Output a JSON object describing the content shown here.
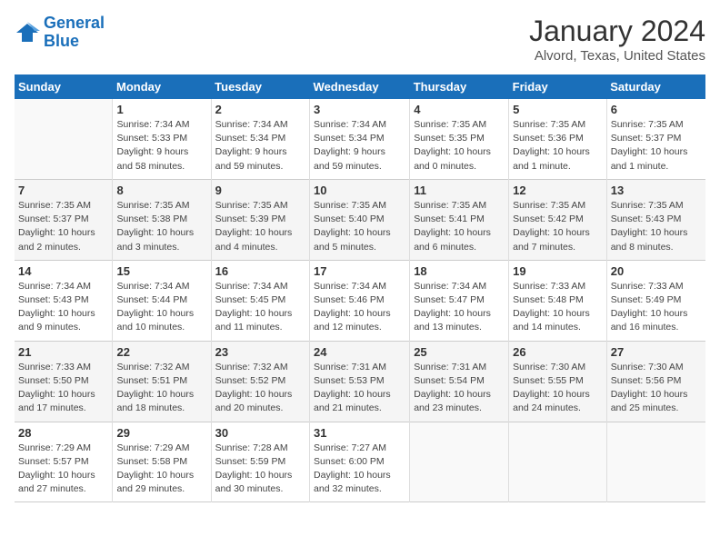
{
  "header": {
    "logo_line1": "General",
    "logo_line2": "Blue",
    "month": "January 2024",
    "location": "Alvord, Texas, United States"
  },
  "weekdays": [
    "Sunday",
    "Monday",
    "Tuesday",
    "Wednesday",
    "Thursday",
    "Friday",
    "Saturday"
  ],
  "weeks": [
    [
      {
        "day": "",
        "detail": ""
      },
      {
        "day": "1",
        "detail": "Sunrise: 7:34 AM\nSunset: 5:33 PM\nDaylight: 9 hours\nand 58 minutes."
      },
      {
        "day": "2",
        "detail": "Sunrise: 7:34 AM\nSunset: 5:34 PM\nDaylight: 9 hours\nand 59 minutes."
      },
      {
        "day": "3",
        "detail": "Sunrise: 7:34 AM\nSunset: 5:34 PM\nDaylight: 9 hours\nand 59 minutes."
      },
      {
        "day": "4",
        "detail": "Sunrise: 7:35 AM\nSunset: 5:35 PM\nDaylight: 10 hours\nand 0 minutes."
      },
      {
        "day": "5",
        "detail": "Sunrise: 7:35 AM\nSunset: 5:36 PM\nDaylight: 10 hours\nand 1 minute."
      },
      {
        "day": "6",
        "detail": "Sunrise: 7:35 AM\nSunset: 5:37 PM\nDaylight: 10 hours\nand 1 minute."
      }
    ],
    [
      {
        "day": "7",
        "detail": "Sunrise: 7:35 AM\nSunset: 5:37 PM\nDaylight: 10 hours\nand 2 minutes."
      },
      {
        "day": "8",
        "detail": "Sunrise: 7:35 AM\nSunset: 5:38 PM\nDaylight: 10 hours\nand 3 minutes."
      },
      {
        "day": "9",
        "detail": "Sunrise: 7:35 AM\nSunset: 5:39 PM\nDaylight: 10 hours\nand 4 minutes."
      },
      {
        "day": "10",
        "detail": "Sunrise: 7:35 AM\nSunset: 5:40 PM\nDaylight: 10 hours\nand 5 minutes."
      },
      {
        "day": "11",
        "detail": "Sunrise: 7:35 AM\nSunset: 5:41 PM\nDaylight: 10 hours\nand 6 minutes."
      },
      {
        "day": "12",
        "detail": "Sunrise: 7:35 AM\nSunset: 5:42 PM\nDaylight: 10 hours\nand 7 minutes."
      },
      {
        "day": "13",
        "detail": "Sunrise: 7:35 AM\nSunset: 5:43 PM\nDaylight: 10 hours\nand 8 minutes."
      }
    ],
    [
      {
        "day": "14",
        "detail": "Sunrise: 7:34 AM\nSunset: 5:43 PM\nDaylight: 10 hours\nand 9 minutes."
      },
      {
        "day": "15",
        "detail": "Sunrise: 7:34 AM\nSunset: 5:44 PM\nDaylight: 10 hours\nand 10 minutes."
      },
      {
        "day": "16",
        "detail": "Sunrise: 7:34 AM\nSunset: 5:45 PM\nDaylight: 10 hours\nand 11 minutes."
      },
      {
        "day": "17",
        "detail": "Sunrise: 7:34 AM\nSunset: 5:46 PM\nDaylight: 10 hours\nand 12 minutes."
      },
      {
        "day": "18",
        "detail": "Sunrise: 7:34 AM\nSunset: 5:47 PM\nDaylight: 10 hours\nand 13 minutes."
      },
      {
        "day": "19",
        "detail": "Sunrise: 7:33 AM\nSunset: 5:48 PM\nDaylight: 10 hours\nand 14 minutes."
      },
      {
        "day": "20",
        "detail": "Sunrise: 7:33 AM\nSunset: 5:49 PM\nDaylight: 10 hours\nand 16 minutes."
      }
    ],
    [
      {
        "day": "21",
        "detail": "Sunrise: 7:33 AM\nSunset: 5:50 PM\nDaylight: 10 hours\nand 17 minutes."
      },
      {
        "day": "22",
        "detail": "Sunrise: 7:32 AM\nSunset: 5:51 PM\nDaylight: 10 hours\nand 18 minutes."
      },
      {
        "day": "23",
        "detail": "Sunrise: 7:32 AM\nSunset: 5:52 PM\nDaylight: 10 hours\nand 20 minutes."
      },
      {
        "day": "24",
        "detail": "Sunrise: 7:31 AM\nSunset: 5:53 PM\nDaylight: 10 hours\nand 21 minutes."
      },
      {
        "day": "25",
        "detail": "Sunrise: 7:31 AM\nSunset: 5:54 PM\nDaylight: 10 hours\nand 23 minutes."
      },
      {
        "day": "26",
        "detail": "Sunrise: 7:30 AM\nSunset: 5:55 PM\nDaylight: 10 hours\nand 24 minutes."
      },
      {
        "day": "27",
        "detail": "Sunrise: 7:30 AM\nSunset: 5:56 PM\nDaylight: 10 hours\nand 25 minutes."
      }
    ],
    [
      {
        "day": "28",
        "detail": "Sunrise: 7:29 AM\nSunset: 5:57 PM\nDaylight: 10 hours\nand 27 minutes."
      },
      {
        "day": "29",
        "detail": "Sunrise: 7:29 AM\nSunset: 5:58 PM\nDaylight: 10 hours\nand 29 minutes."
      },
      {
        "day": "30",
        "detail": "Sunrise: 7:28 AM\nSunset: 5:59 PM\nDaylight: 10 hours\nand 30 minutes."
      },
      {
        "day": "31",
        "detail": "Sunrise: 7:27 AM\nSunset: 6:00 PM\nDaylight: 10 hours\nand 32 minutes."
      },
      {
        "day": "",
        "detail": ""
      },
      {
        "day": "",
        "detail": ""
      },
      {
        "day": "",
        "detail": ""
      }
    ]
  ]
}
